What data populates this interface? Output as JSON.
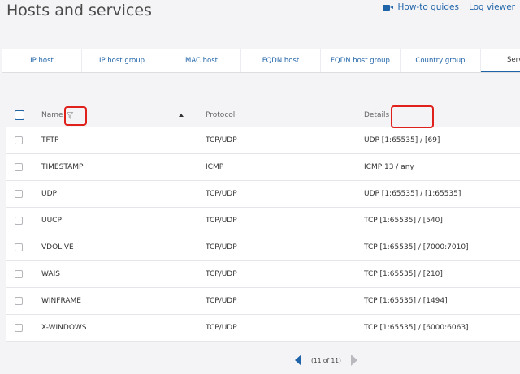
{
  "page": {
    "title": "Hosts and services"
  },
  "top_links": {
    "howto": "How-to guides",
    "log_viewer": "Log viewer"
  },
  "tabs": [
    {
      "label": "IP host"
    },
    {
      "label": "IP host group"
    },
    {
      "label": "MAC host"
    },
    {
      "label": "FQDN host"
    },
    {
      "label": "FQDN host group"
    },
    {
      "label": "Country group"
    },
    {
      "label": "Services"
    }
  ],
  "table": {
    "headers": {
      "name": "Name",
      "protocol": "Protocol",
      "details": "Details"
    },
    "rows": [
      {
        "name": "TFTP",
        "protocol": "TCP/UDP",
        "details": "UDP [1:65535] / [69]"
      },
      {
        "name": "TIMESTAMP",
        "protocol": "ICMP",
        "details": "ICMP 13 / any"
      },
      {
        "name": "UDP",
        "protocol": "TCP/UDP",
        "details": "UDP [1:65535] / [1:65535]"
      },
      {
        "name": "UUCP",
        "protocol": "TCP/UDP",
        "details": "TCP [1:65535] / [540]"
      },
      {
        "name": "VDOLIVE",
        "protocol": "TCP/UDP",
        "details": "TCP [1:65535] / [7000:7010]"
      },
      {
        "name": "WAIS",
        "protocol": "TCP/UDP",
        "details": "TCP [1:65535] / [210]"
      },
      {
        "name": "WINFRAME",
        "protocol": "TCP/UDP",
        "details": "TCP [1:65535] / [1494]"
      },
      {
        "name": "X-WINDOWS",
        "protocol": "TCP/UDP",
        "details": "TCP [1:65535] / [6000:6063]"
      }
    ]
  },
  "pager": {
    "label": "(11 of 11)"
  },
  "colors": {
    "accent": "#1f63a8",
    "highlight": "#e0201b"
  }
}
